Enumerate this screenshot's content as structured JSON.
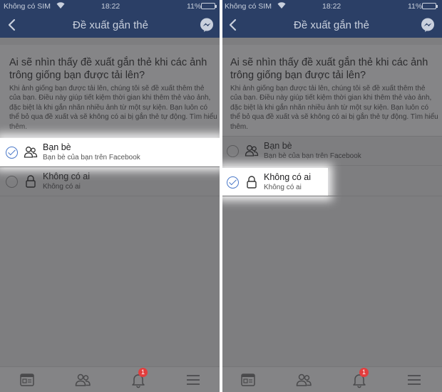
{
  "colors": {
    "navbar_bg": "#2b3f66",
    "overlay_gray": "#7e7e80",
    "check_blue": "#4a78c8",
    "badge_red": "#e23e3e"
  },
  "screens": [
    {
      "statusbar": {
        "carrier": "Không có SIM",
        "time": "18:22",
        "battery": "11%"
      },
      "navbar": {
        "back_icon": "chevron-left-icon",
        "title": "Đề xuất gắn thẻ",
        "messenger_icon": "messenger-icon"
      },
      "question": "Ai sẽ nhìn thấy đề xuất gắn thẻ khi các ảnh trông giống bạn được tải lên?",
      "description": "Khi ảnh giống bạn được tải lên, chúng tôi sẽ đề xuất thêm thẻ của bạn. Điều này giúp tiết kiệm thời gian khi thêm thẻ vào ảnh, đặc biệt là khi gắn nhãn nhiều ảnh từ một sự kiện. Bạn luôn có thể bỏ qua đề xuất và sẽ không có ai bị gắn thẻ tự động. Tìm hiểu thêm.",
      "options": [
        {
          "label": "Bạn bè",
          "sublabel": "Bạn bè của bạn trên Facebook",
          "icon": "friends-icon",
          "selected": true
        },
        {
          "label": "Không có ai",
          "sublabel": "Không có ai",
          "icon": "lock-icon",
          "selected": false
        }
      ],
      "tabbar": {
        "notifications_badge": "1"
      }
    },
    {
      "statusbar": {
        "carrier": "Không có SIM",
        "time": "18:22",
        "battery": "11%"
      },
      "navbar": {
        "back_icon": "chevron-left-icon",
        "title": "Đề xuất gắn thẻ",
        "messenger_icon": "messenger-icon"
      },
      "question": "Ai sẽ nhìn thấy đề xuất gắn thẻ khi các ảnh trông giống bạn được tải lên?",
      "description": "Khi ảnh giống bạn được tải lên, chúng tôi sẽ đề xuất thêm thẻ của bạn. Điều này giúp tiết kiệm thời gian khi thêm thẻ vào ảnh, đặc biệt là khi gắn nhãn nhiều ảnh từ một sự kiện. Bạn luôn có thể bỏ qua đề xuất và sẽ không có ai bị gắn thẻ tự động. Tìm hiểu thêm.",
      "options": [
        {
          "label": "Bạn bè",
          "sublabel": "Bạn bè của bạn trên Facebook",
          "icon": "friends-icon",
          "selected": false
        },
        {
          "label": "Không có ai",
          "sublabel": "Không có ai",
          "icon": "lock-icon",
          "selected": true
        }
      ],
      "tabbar": {
        "notifications_badge": "1"
      }
    }
  ]
}
